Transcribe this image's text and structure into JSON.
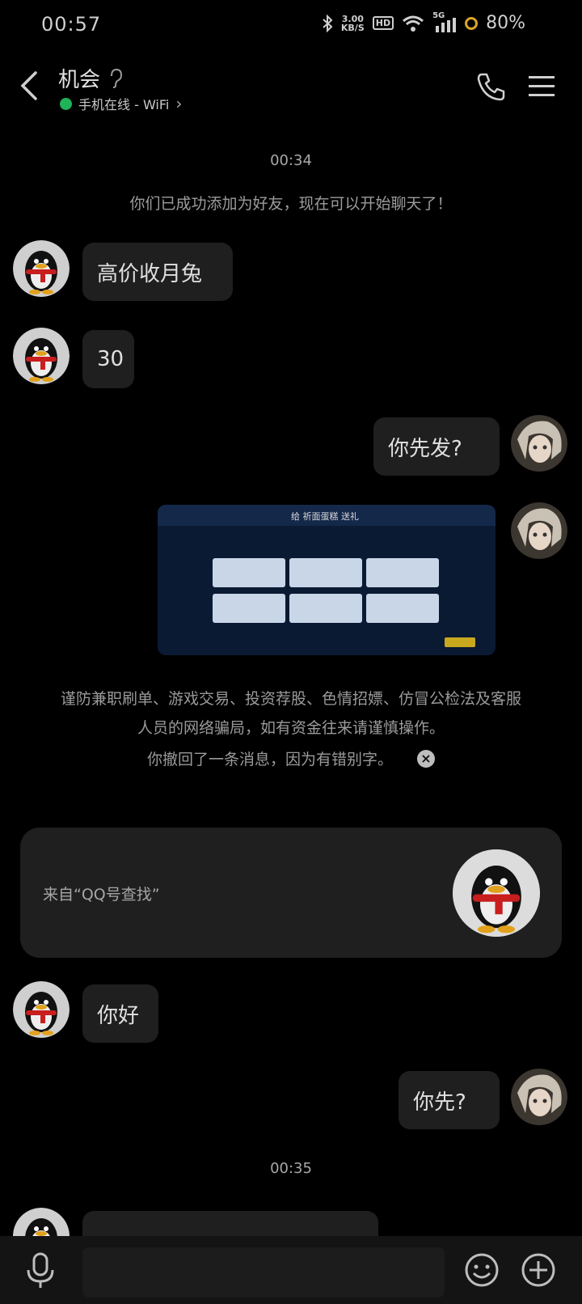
{
  "status_bar": {
    "time": "00:57",
    "net_speed_value": "3.00",
    "net_speed_unit": "KB/S",
    "hd_label": "HD",
    "network_type": "5G",
    "battery": "80%"
  },
  "header": {
    "contact_name": "机会",
    "presence": "手机在线 - WiFi",
    "presence_chevron": "›"
  },
  "messages": {
    "time_1": "00:34",
    "friend_added": "你们已成功添加为好友，现在可以开始聊天了！",
    "msg_1": "高价收月兔",
    "msg_2": "30",
    "msg_3": "你先发?",
    "image_title": "给 祈面蛋糕 送礼",
    "fraud_warning_line1": "谨防兼职刷单、游戏交易、投资荐股、色情招嫖、仿冒公检法及客服",
    "fraud_warning_line2": "人员的网络骗局，如有资金往来请谨慎操作。",
    "recalled_notice": "你撤回了一条消息，因为有错别字。",
    "recalled_close": "×",
    "card_source": "来自“QQ号查找”",
    "msg_4": "你好",
    "msg_5": "你先?",
    "time_2": "00:35"
  },
  "icons": {
    "back": "back-arrow-icon",
    "call": "phone-icon",
    "menu": "menu-icon",
    "voice": "microphone-icon",
    "emoji": "emoji-icon",
    "plus": "plus-icon"
  },
  "colors": {
    "background": "#000000",
    "bubble": "#1f1f1f",
    "online_dot": "#1fb35a"
  }
}
